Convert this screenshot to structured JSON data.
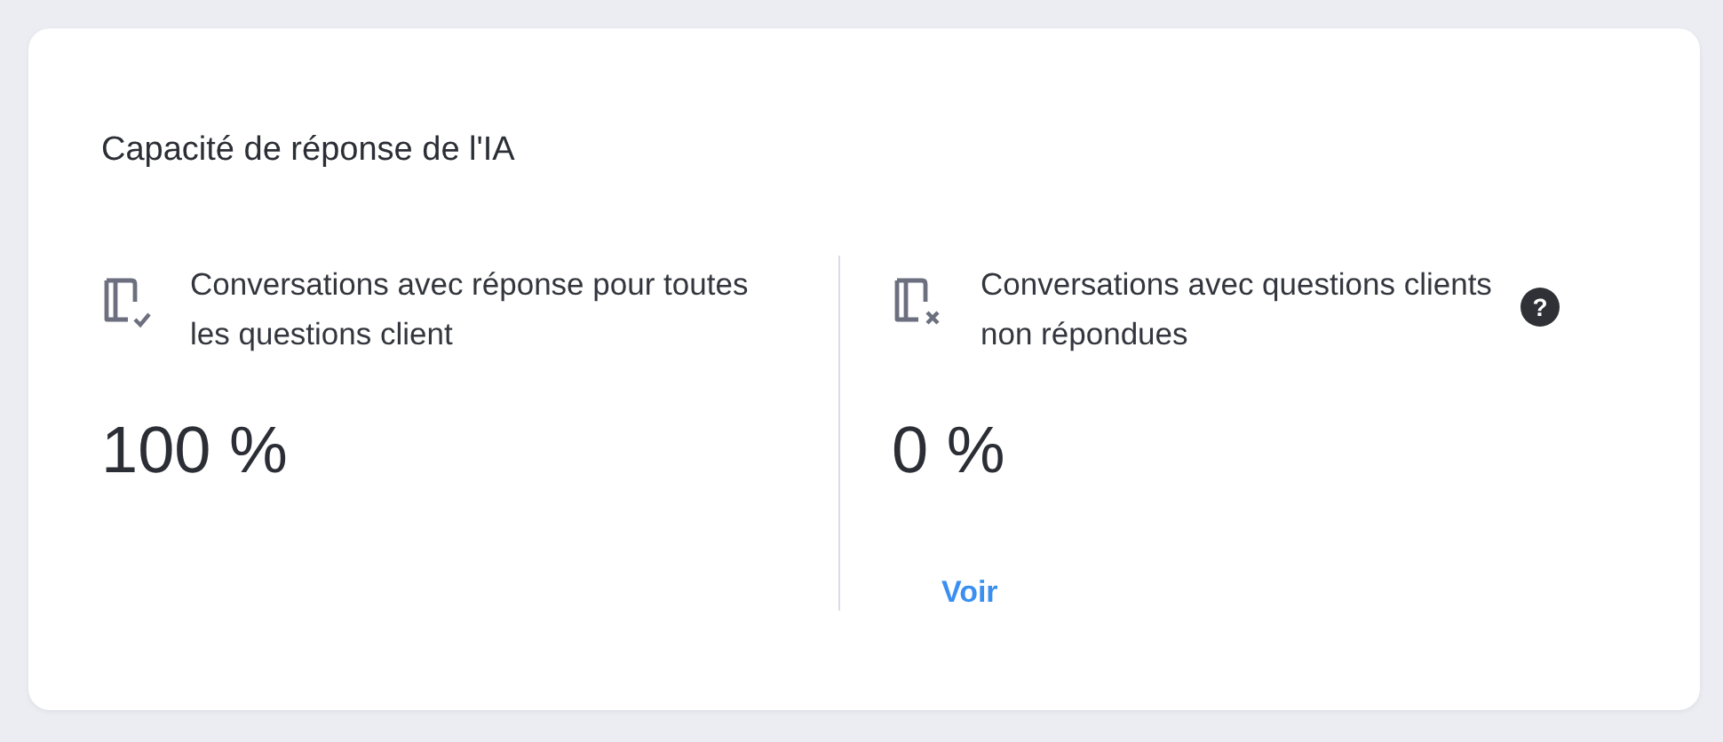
{
  "card": {
    "title": "Capacité de réponse de l'IA",
    "metrics": [
      {
        "kind": "answered",
        "label": "Conversations avec réponse pour toutes les questions client",
        "value": "100 %"
      },
      {
        "kind": "unanswered",
        "label": "Conversations avec questions clients non répondues",
        "help": "?",
        "value": "0 %",
        "link": "Voir"
      }
    ]
  }
}
